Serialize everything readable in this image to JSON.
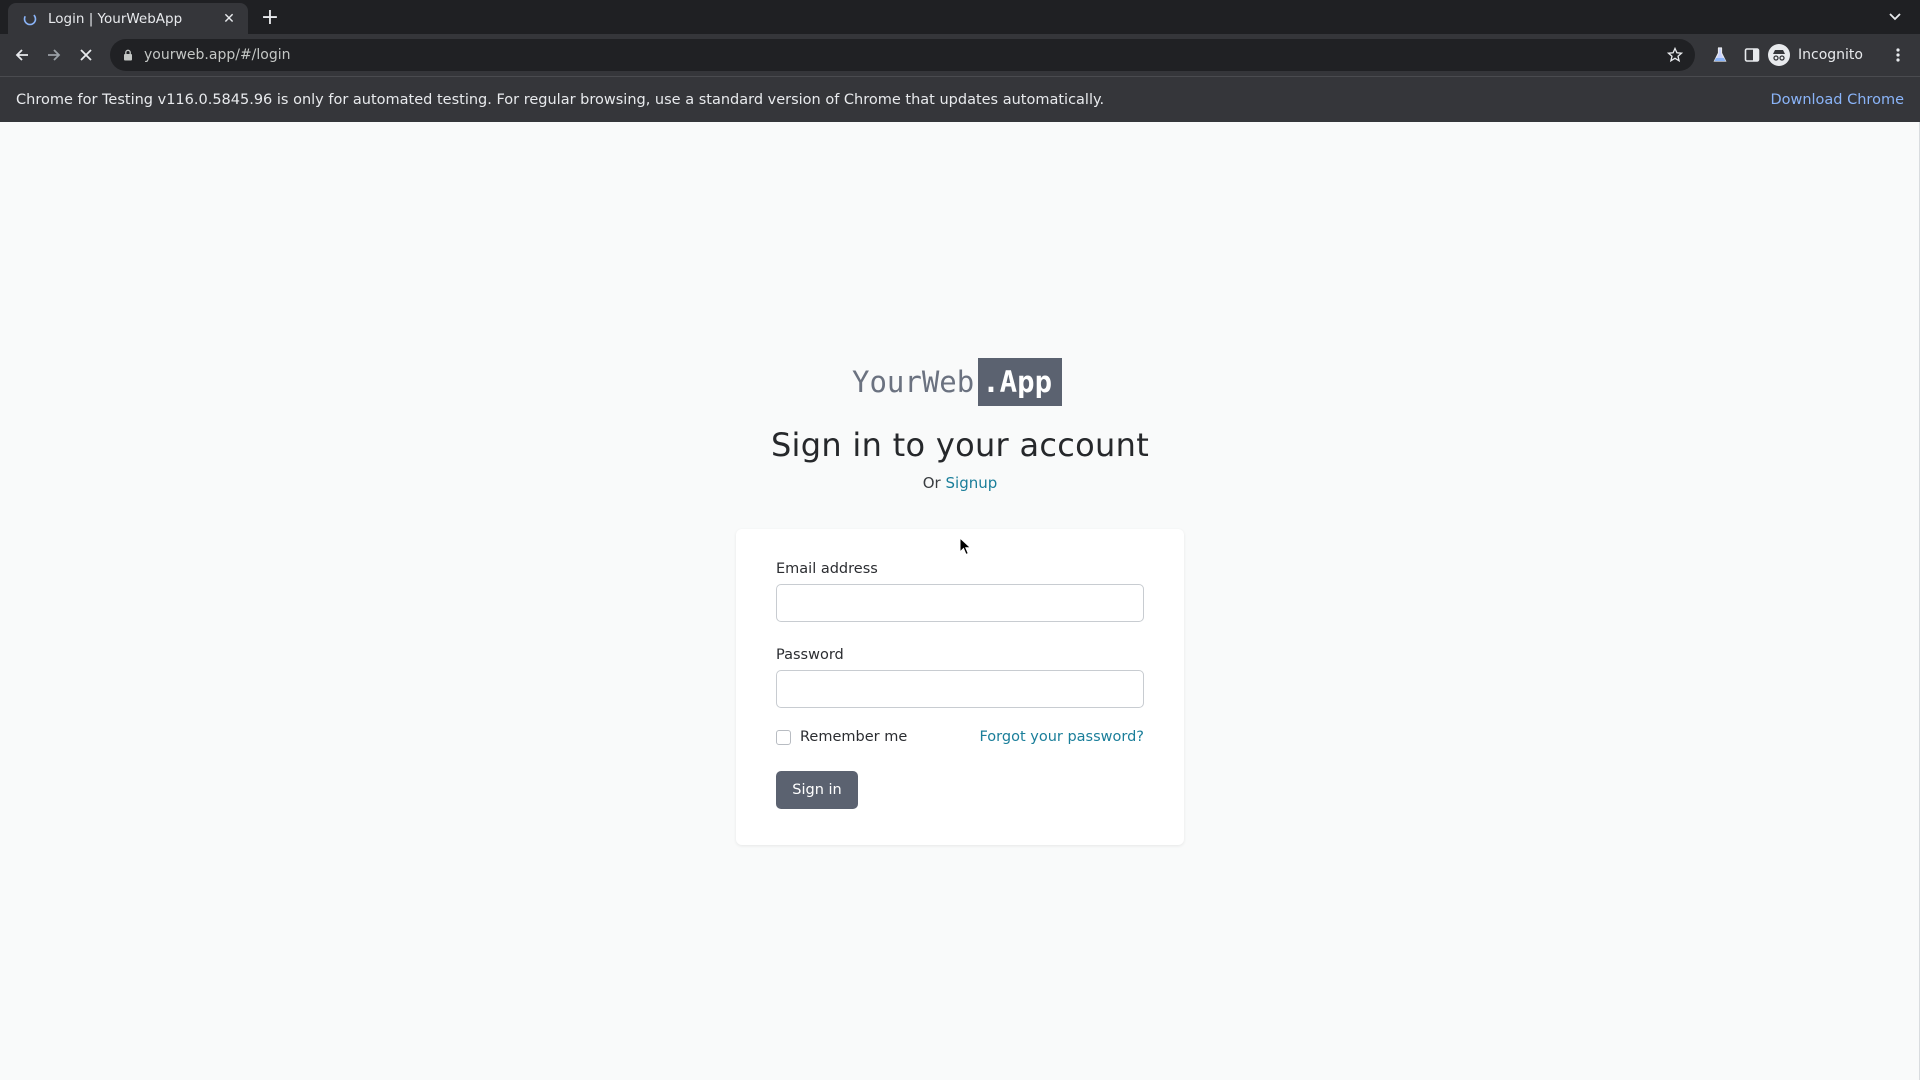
{
  "browser": {
    "tab": {
      "title": "Login | YourWebApp",
      "favicon": "spinner-icon"
    },
    "address": {
      "url": "yourweb.app/#/login"
    },
    "profile": {
      "label": "Incognito"
    },
    "infobar": {
      "message": "Chrome for Testing v116.0.5845.96 is only for automated testing. For regular browsing, use a standard version of Chrome that updates automatically.",
      "action": "Download Chrome"
    }
  },
  "page": {
    "logo": {
      "left": "YourWeb",
      "right": ".App"
    },
    "title": "Sign in to your account",
    "subtitle": {
      "prefix": "Or",
      "link": "Signup"
    },
    "form": {
      "email_label": "Email address",
      "email_value": "",
      "password_label": "Password",
      "password_value": "",
      "remember_label": "Remember me",
      "forgot_label": "Forgot your password?",
      "submit_label": "Sign in"
    }
  },
  "colors": {
    "accent_link": "#1a7e9a",
    "button": "#5b6270",
    "page_bg": "#f9fafa"
  }
}
